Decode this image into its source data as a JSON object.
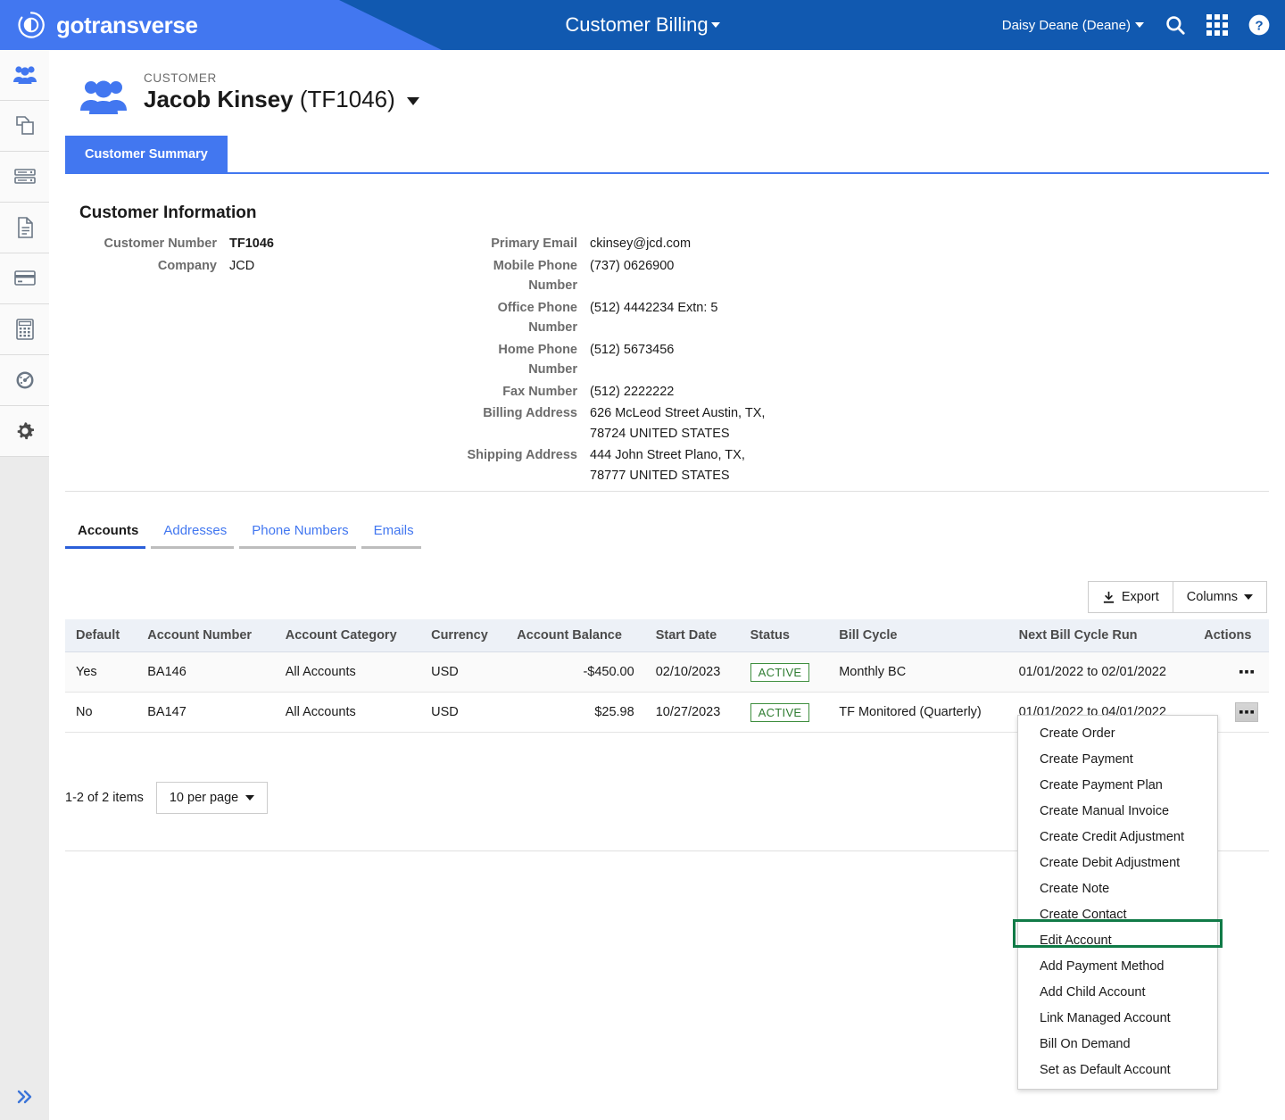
{
  "topbar": {
    "logo_text": "gotransverse",
    "logo_icon": "gotransverse-circle-logo",
    "title": "Customer Billing",
    "user": "Daisy Deane (Deane)",
    "search_icon": "search-icon",
    "apps_icon": "apps-grid-icon",
    "help_icon": "help-circle-icon"
  },
  "sidebar": {
    "items": [
      {
        "icon": "customers-icon",
        "name": "customers"
      },
      {
        "icon": "products-icon",
        "name": "products"
      },
      {
        "icon": "servers-icon",
        "name": "usage"
      },
      {
        "icon": "document-icon",
        "name": "billing-documents"
      },
      {
        "icon": "credit-card-icon",
        "name": "payments"
      },
      {
        "icon": "calculator-icon",
        "name": "accounting"
      },
      {
        "icon": "gauge-icon",
        "name": "reports"
      },
      {
        "icon": "gear-icon",
        "name": "settings"
      }
    ],
    "expand_icon": "double-chevron-right-icon"
  },
  "customer": {
    "eyebrow": "CUSTOMER",
    "name": "Jacob Kinsey",
    "number_paren": "(TF1046)",
    "avatar_icon": "customer-group-icon",
    "summary_tab": "Customer Summary"
  },
  "customer_information": {
    "heading": "Customer Information",
    "left_fields": [
      {
        "label": "Customer Number",
        "value": "TF1046",
        "bold": true
      },
      {
        "label": "Company",
        "value": "JCD",
        "bold": false
      }
    ],
    "right_fields": [
      {
        "label": "Primary Email",
        "value": "ckinsey@jcd.com"
      },
      {
        "label": "Mobile Phone Number",
        "value": "(737) 0626900"
      },
      {
        "label": "Office Phone Number",
        "value": "(512) 4442234 Extn: 5"
      },
      {
        "label": "Home Phone Number",
        "value": "(512) 5673456"
      },
      {
        "label": "Fax Number",
        "value": "(512) 2222222"
      },
      {
        "label": "Billing Address",
        "value": "626 McLeod Street Austin, TX, 78724 UNITED STATES"
      },
      {
        "label": "Shipping Address",
        "value": "444 John Street Plano, TX, 78777 UNITED STATES"
      }
    ]
  },
  "subtabs": [
    {
      "label": "Accounts",
      "active": true
    },
    {
      "label": "Addresses",
      "active": false
    },
    {
      "label": "Phone Numbers",
      "active": false
    },
    {
      "label": "Emails",
      "active": false
    }
  ],
  "toolbar": {
    "export_label": "Export",
    "export_icon": "download-icon",
    "columns_label": "Columns",
    "columns_caret_icon": "caret-down-icon"
  },
  "table": {
    "columns": [
      "Default",
      "Account Number",
      "Account Category",
      "Currency",
      "Account Balance",
      "Start Date",
      "Status",
      "Bill Cycle",
      "Next Bill Cycle Run",
      "Actions"
    ],
    "rows": [
      {
        "default": "Yes",
        "account_number": "BA146",
        "account_category": "All Accounts",
        "currency": "USD",
        "account_balance": "-$450.00",
        "start_date": "02/10/2023",
        "status": "ACTIVE",
        "bill_cycle": "Monthly BC",
        "next_bill_cycle_run": "01/01/2022 to 02/01/2022",
        "actions_icon": "ellipsis-icon"
      },
      {
        "default": "No",
        "account_number": "BA147",
        "account_category": "All Accounts",
        "currency": "USD",
        "account_balance": "$25.98",
        "start_date": "10/27/2023",
        "status": "ACTIVE",
        "bill_cycle": "TF Monitored (Quarterly)",
        "next_bill_cycle_run": "01/01/2022 to 04/01/2022",
        "actions_icon": "ellipsis-icon"
      }
    ]
  },
  "pagination": {
    "summary": "1-2 of 2 items",
    "per_page": "10 per page",
    "caret_icon": "caret-down-icon"
  },
  "actions_menu": {
    "items": [
      "Create Order",
      "Create Payment",
      "Create Payment Plan",
      "Create Manual Invoice",
      "Create Credit Adjustment",
      "Create Debit Adjustment",
      "Create Note",
      "Create Contact",
      "Edit Account",
      "Add Payment Method",
      "Add Child Account",
      "Link Managed Account",
      "Bill On Demand",
      "Set as Default Account"
    ],
    "highlighted_index": 6
  },
  "colors": {
    "header_dark_blue": "#1159b0",
    "header_light_blue": "#4277f0",
    "link_blue": "#4277f0",
    "active_green": "#2f7d32",
    "highlight_green": "#107a47"
  }
}
